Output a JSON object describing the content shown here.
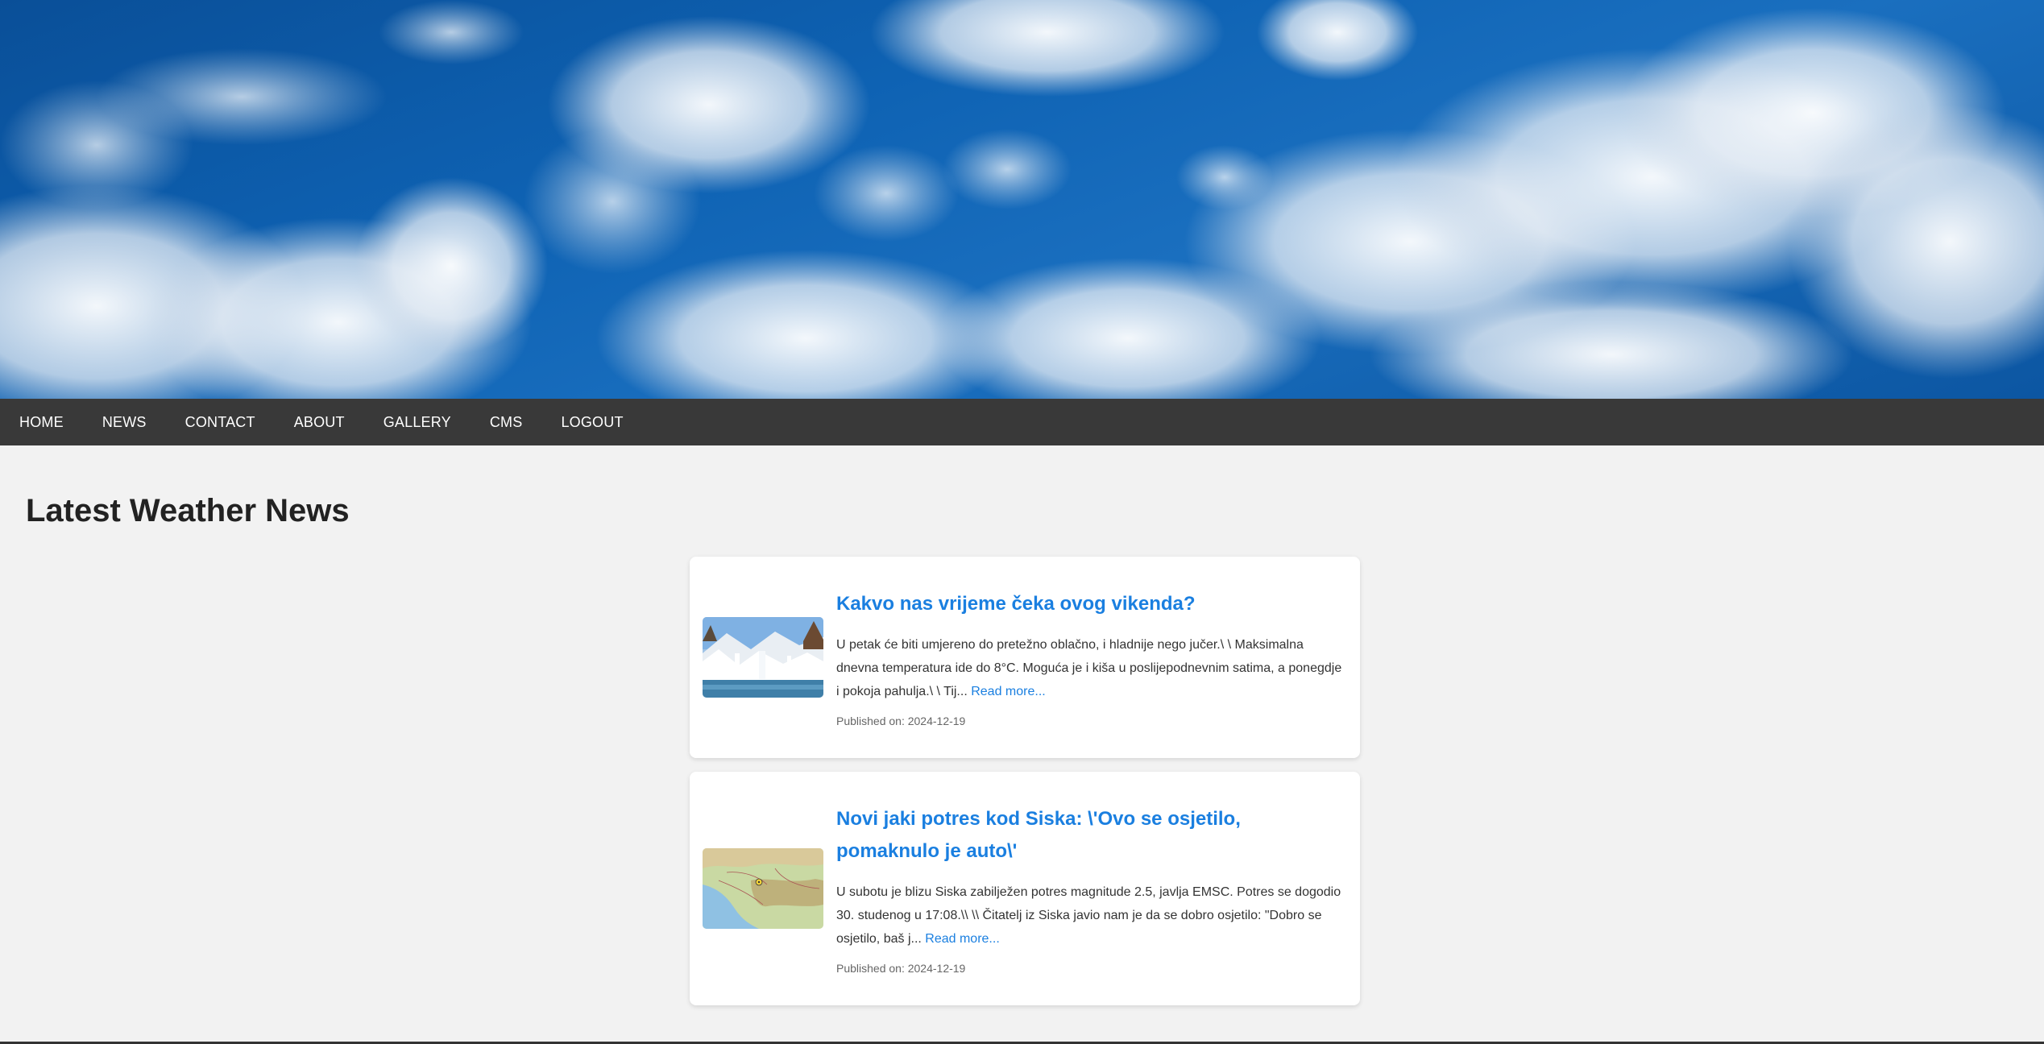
{
  "nav": {
    "items": [
      "HOME",
      "NEWS",
      "CONTACT",
      "ABOUT",
      "GALLERY",
      "CMS",
      "LOGOUT"
    ]
  },
  "page": {
    "title": "Latest Weather News"
  },
  "articles": [
    {
      "title": "Kakvo nas vrijeme čeka ovog vikenda?",
      "excerpt": "U petak će biti umjereno do pretežno oblačno, i hladnije nego jučer.\\ \\ Maksimalna dnevna temperatura ide do 8°C. Moguća je i kiša u poslijepodnevnim satima, a ponegdje i pokoja pahulja.\\ \\ Tij...",
      "read_more": "Read more...",
      "published": "Published on: 2024-12-19",
      "thumbnail": "waterfall-winter-image"
    },
    {
      "title": "Novi jaki potres kod Siska: \\'Ovo se osjetilo, pomaknulo je auto\\'",
      "excerpt": "U subotu je blizu Siska zabilježen potres magnitude 2.5, javlja EMSC. Potres se dogodio 30. studenog u 17:08.\\\\ \\\\ Čitatelj iz Siska javio nam je da se dobro osjetilo: \"Dobro se osjetilo, baš j...",
      "read_more": "Read more...",
      "published": "Published on: 2024-12-19",
      "thumbnail": "earthquake-map-image"
    }
  ],
  "colors": {
    "nav_bg": "#393939",
    "link": "#1a7fe0",
    "page_bg": "#f2f2f2"
  }
}
